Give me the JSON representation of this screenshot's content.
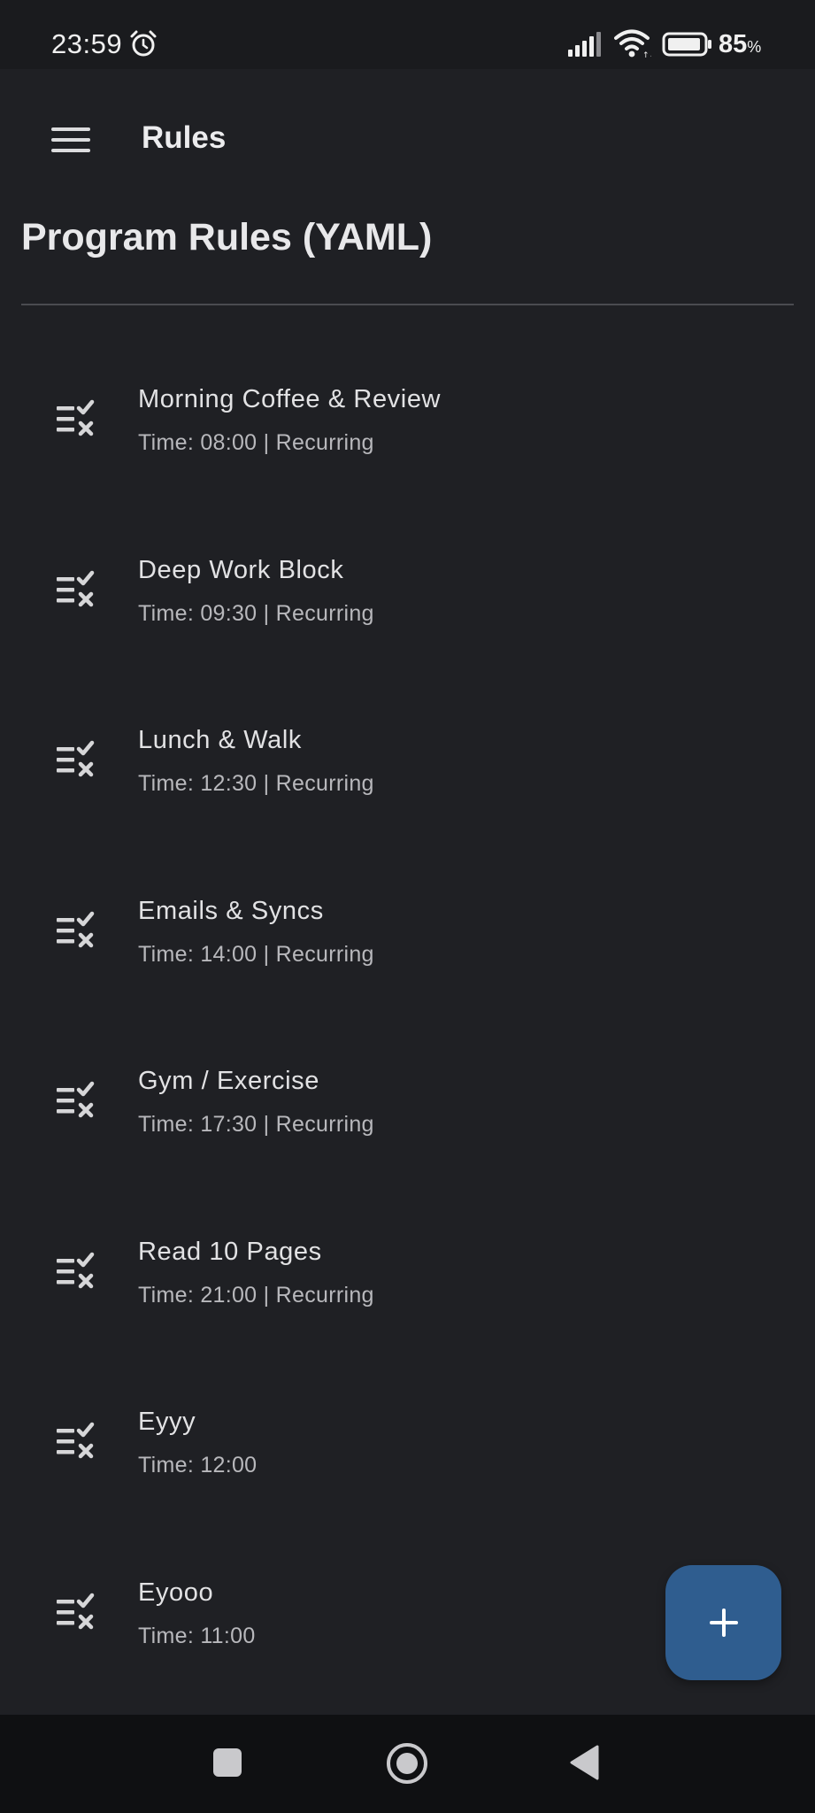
{
  "status_bar": {
    "time": "23:59",
    "battery_level": "85",
    "battery_unit": "%",
    "icons": [
      "alarm-icon",
      "signal-icon",
      "wifi-icon",
      "battery-icon"
    ]
  },
  "app_bar": {
    "menu_icon": "hamburger-menu-icon",
    "title": "Rules"
  },
  "page": {
    "title": "Program Rules (YAML)"
  },
  "rules": [
    {
      "title": "Morning Coffee & Review",
      "subtitle": "Time: 08:00 | Recurring",
      "icon": "checklist-icon"
    },
    {
      "title": "Deep Work Block",
      "subtitle": "Time: 09:30 | Recurring",
      "icon": "checklist-icon"
    },
    {
      "title": "Lunch & Walk",
      "subtitle": "Time: 12:30 | Recurring",
      "icon": "checklist-icon"
    },
    {
      "title": "Emails & Syncs",
      "subtitle": "Time: 14:00 | Recurring",
      "icon": "checklist-icon"
    },
    {
      "title": "Gym / Exercise",
      "subtitle": "Time: 17:30 | Recurring",
      "icon": "checklist-icon"
    },
    {
      "title": "Read 10 Pages",
      "subtitle": "Time: 21:00 | Recurring",
      "icon": "checklist-icon"
    },
    {
      "title": "Eyyy",
      "subtitle": "Time: 12:00",
      "icon": "checklist-icon"
    },
    {
      "title": "Eyooo",
      "subtitle": "Time: 11:00",
      "icon": "checklist-icon"
    }
  ],
  "fab": {
    "icon": "plus-icon"
  },
  "nav_bar": {
    "icons": [
      "recents-icon",
      "home-icon",
      "back-icon"
    ]
  },
  "colors": {
    "background": "#1f2024",
    "fab": "#2f5d8f",
    "text_primary": "#e2e2e4",
    "text_secondary": "#b8b8bc"
  }
}
